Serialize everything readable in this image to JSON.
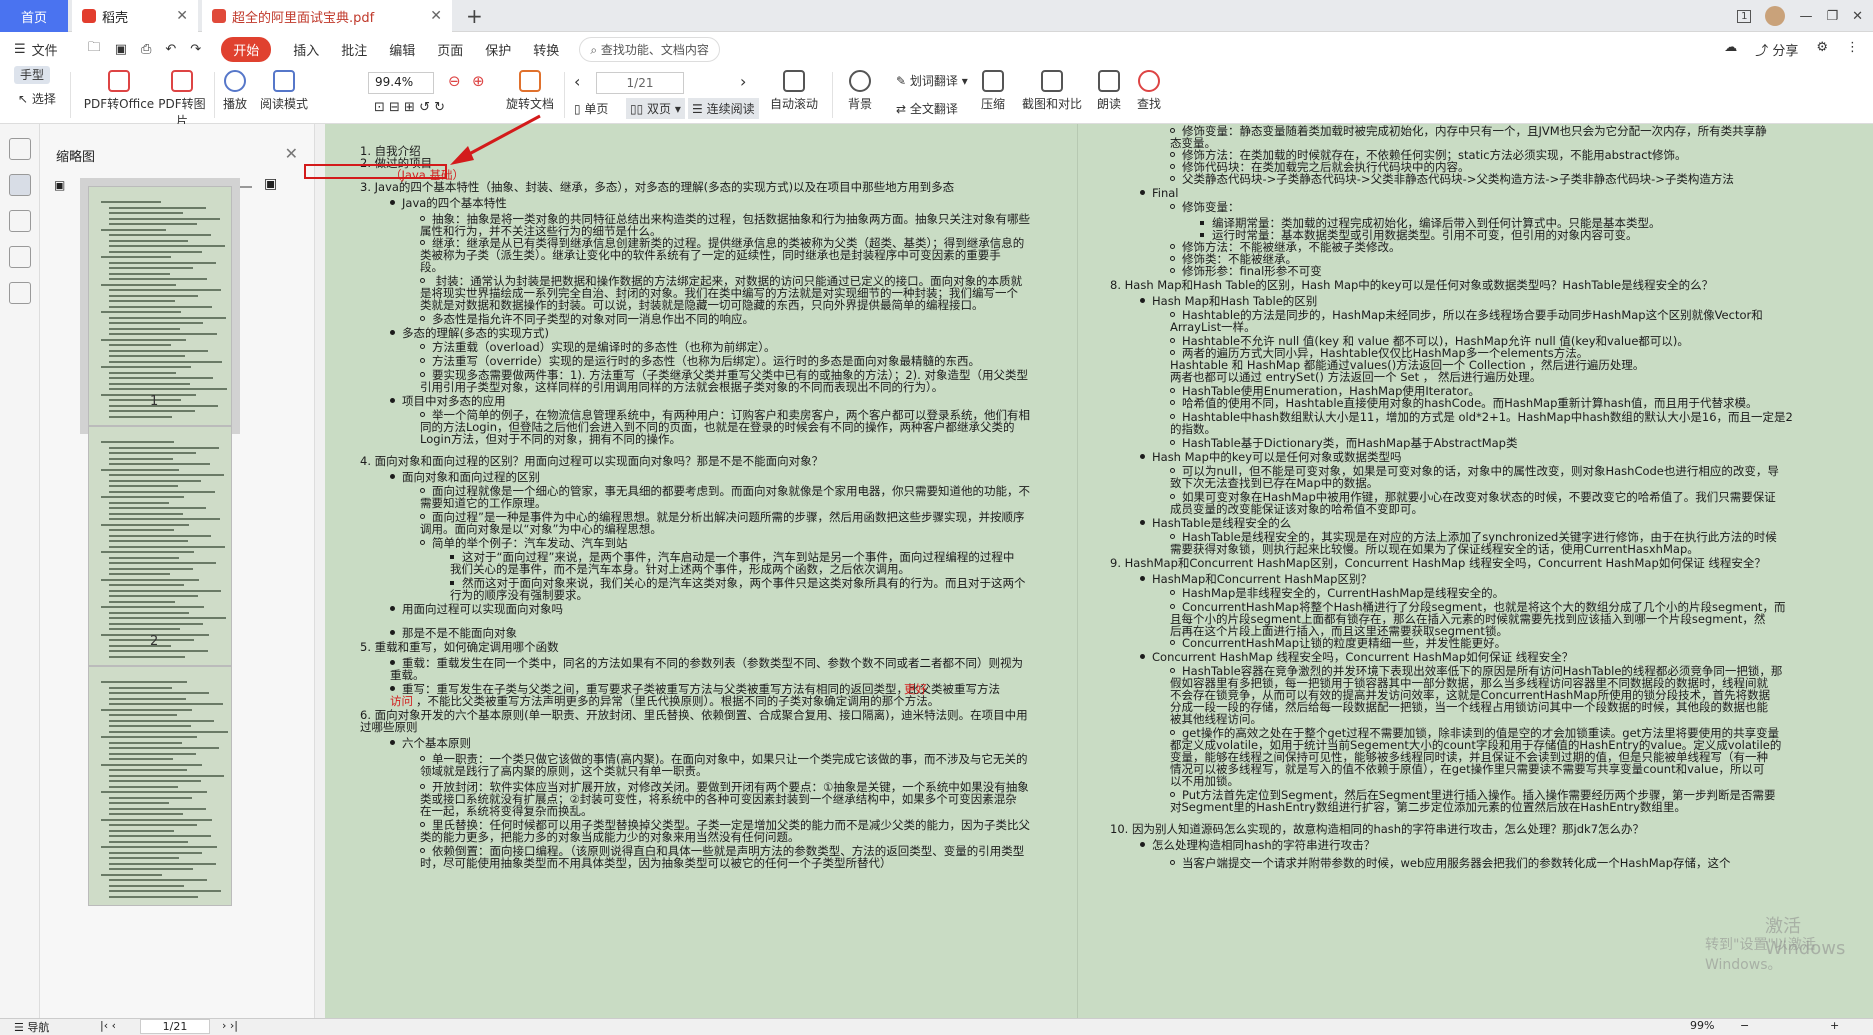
{
  "tabs": {
    "home": "首页",
    "wps": "稻壳",
    "doc": "超全的阿里面试宝典.pdf"
  },
  "winctl": {
    "badge": "1"
  },
  "menu": {
    "file": "文件",
    "start": "开始",
    "items": [
      "插入",
      "批注",
      "编辑",
      "页面",
      "保护",
      "转换"
    ],
    "search": "查找功能、文档内容",
    "share": "分享"
  },
  "toolbar": {
    "hand": "手型",
    "select": "选择",
    "pdf2office": "PDF转Office",
    "pdf2img": "PDF转图片",
    "play": "播放",
    "read": "阅读模式",
    "zoom": "99.4%",
    "rotate": "旋转文档",
    "page": "1/21",
    "single": "单页",
    "double": "双页",
    "continuous": "连续阅读",
    "autoscroll": "自动滚动",
    "bg": "背景",
    "wordtrans": "划词翻译",
    "fulltrans": "全文翻译",
    "compress": "压缩",
    "compare": "截图和对比",
    "tts": "朗读",
    "find": "查找"
  },
  "sidebar": {
    "title": "缩略图",
    "p1": "1",
    "p2": "2"
  },
  "doc_left": [
    "1.  自我介绍",
    "2.  做过的项目",
    "（Java 基础）",
    "3.  Java的四个基本特性（抽象、封装、继承，多态），对多态的理解(多态的实现方式)以及在项目中那些地方用到多态",
    "Java的四个基本特性",
    "抽象：抽象是将一类对象的共同特征总结出来构造类的过程，包括数据抽象和行为抽象两方面。抽象只关注对象有哪些",
    "属性和行为，并不关注这些行为的细节是什么。",
    "继承：继承是从已有类得到继承信息创建新类的过程。提供继承信息的类被称为父类（超类、基类）；得到继承信息的",
    "类被称为子类（派生类）。继承让变化中的软件系统有了一定的延续性，同时继承也是封装程序中可变因素的重要手",
    "段。",
    " 封装：通常认为封装是把数据和操作数据的方法绑定起来，对数据的访问只能通过已定义的接口。面向对象的本质就",
    "是将现实世界描绘成一系列完全自治、封闭的对象。我们在类中编写的方法就是对实现细节的一种封装；我们编写一个",
    "类就是对数据和数据操作的封装。可以说，封装就是隐藏一切可隐藏的东西，只向外界提供最简单的编程接口。",
    "多态性是指允许不同子类型的对象对同一消息作出不同的响应。",
    "多态的理解(多态的实现方式)",
    "方法重载（overload）实现的是编译时的多态性（也称为前绑定）。",
    "方法重写（override）实现的是运行时的多态性（也称为后绑定）。运行时的多态是面向对象最精髓的东西。",
    "要实现多态需要做两件事：1). 方法重写（子类继承父类并重写父类中已有的或抽象的方法）；2). 对象造型（用父类型",
    "引用引用子类型对象，这样同样的引用调用同样的方法就会根据子类对象的不同而表现出不同的行为）。",
    "项目中对多态的应用",
    "举一个简单的例子，在物流信息管理系统中，有两种用户：订购客户和卖房客户，两个客户都可以登录系统，他们有相",
    "同的方法Login，但登陆之后他们会进入到不同的页面，也就是在登录的时候会有不同的操作，两种客户都继承父类的",
    "Login方法，但对于不同的对象，拥有不同的操作。",
    "4.  面向对象和面向过程的区别？用面向过程可以实现面向对象吗？那是不是不能面向对象？",
    "面向对象和面向过程的区别",
    "面向过程就像是一个细心的管家，事无具细的都要考虑到。而面向对象就像是个家用电器，你只需要知道他的功能，不",
    "需要知道它的工作原理。",
    "面向过程”是一种是事件为中心的编程思想。就是分析出解决问题所需的步骤，然后用函数把这些步骤实现，并按顺序",
    "调用。面向对象是以“对象”为中心的编程思想。",
    "简单的举个例子：汽车发动、汽车到站",
    "这对于“面向过程”来说，是两个事件，汽车启动是一个事件，汽车到站是另一个事件，面向过程编程的过程中",
    "我们关心的是事件，而不是汽车本身。针对上述两个事件，形成两个函数，之后依次调用。",
    "然而这对于面向对象来说，我们关心的是汽车这类对象，两个事件只是这类对象所具有的行为。而且对于这两个",
    "行为的顺序没有强制要求。",
    "用面向过程可以实现面向对象吗",
    "那是不是不能面向对象",
    "5.  重载和重写，如何确定调用哪个函数",
    "重载：重载发生在同一个类中，同名的方法如果有不同的参数列表（参数类型不同、参数个数不同或者二者都不同）则视为",
    "重载。",
    "重写：重写发生在子类与父类之间，重写要求子类被重写方法与父类被重写方法有相同的返回类型，比父类被重写方法",
    "更好",
    "访问",
    "，不能比父类被重写方法声明更多的异常（里氏代换原则）。根据不同的子类对象确定调用的那个方法。",
    "6.  面向对象开发的六个基本原则(单一职责、开放封闭、里氏替换、依赖倒置、合成聚合复用、接口隔离)，迪米特法则。在项目中用",
    "过哪些原则",
    "六个基本原则",
    "单一职责：一个类只做它该做的事情(高内聚)。在面向对象中，如果只让一个类完成它该做的事，而不涉及与它无关的",
    "领域就是践行了高内聚的原则，这个类就只有单一职责。",
    "开放封闭：软件实体应当对扩展开放，对修改关闭。要做到开闭有两个要点：①抽象是关键，一个系统中如果没有抽象",
    "类或接口系统就没有扩展点；②封装可变性，将系统中的各种可变因素封装到一个继承结构中，如果多个可变因素混杂",
    "在一起，系统将变得复杂而换乱。",
    "里氏替换：任何时候都可以用子类型替换掉父类型。子类一定是增加父类的能力而不是减少父类的能力，因为子类比父",
    "类的能力更多，把能力多的对象当成能力少的对象来用当然没有任何问题。",
    "依赖倒置：面向接口编程。（该原则说得直白和具体一些就是声明方法的参数类型、方法的返回类型、变量的引用类型",
    "时，尽可能使用抽象类型而不用具体类型，因为抽象类型可以被它的任何一个子类型所替代）"
  ],
  "doc_right": [
    "修饰变量：静态变量随着类加载时被完成初始化，内存中只有一个，且JVM也只会为它分配一次内存，所有类共享静",
    "态变量。",
    "修饰方法：在类加载的时候就存在，不依赖任何实例；static方法必须实现，不能用abstract修饰。",
    "修饰代码块：在类加载完之后就会执行代码块中的内容。",
    "父类静态代码块->子类静态代码块->父类非静态代码块->父类构造方法->子类非静态代码块->子类构造方法",
    "Final",
    "修饰变量：",
    "编译期常量：类加载的过程完成初始化，编译后带入到任何计算式中。只能是基本类型。",
    "运行时常量：基本数据类型或引用数据类型。引用不可变，但引用的对象内容可变。",
    "修饰方法：不能被继承，不能被子类修改。",
    "修饰类：不能被继承。",
    "修饰形参：final形参不可变",
    "8.  Hash Map和Hash Table的区别，Hash Map中的key可以是任何对象或数据类型吗？HashTable是线程安全的么？",
    "Hash Map和Hash Table的区别",
    "Hashtable的方法是同步的，HashMap未经同步，所以在多线程场合要手动同步HashMap这个区别就像Vector和",
    "ArrayList一样。",
    "Hashtable不允许 null 值(key 和 value 都不可以)，HashMap允许 null 值(key和value都可以)。",
    "两者的遍历方式大同小异，Hashtable仅仅比HashMap多一个elements方法。",
    "Hashtable 和 HashMap 都能通过values()方法返回一个 Collection ，然后进行遍历处理。",
    "两者也都可以通过 entrySet() 方法返回一个 Set ， 然后进行遍历处理。",
    "HashTable使用Enumeration，HashMap使用Iterator。",
    "哈希值的使用不同，Hashtable直接使用对象的hashCode。而HashMap重新计算hash值，而且用于代替求模。",
    "Hashtable中hash数组默认大小是11，增加的方式是 old*2+1。HashMap中hash数组的默认大小是16，而且一定是2",
    "的指数。",
    "HashTable基于Dictionary类，而HashMap基于AbstractMap类",
    "Hash Map中的key可以是任何对象或数据类型吗",
    "可以为null，但不能是可变对象，如果是可变对象的话，对象中的属性改变，则对象HashCode也进行相应的改变，导",
    "致下次无法查找到已存在Map中的数据。",
    "如果可变对象在HashMap中被用作键，那就要小心在改变对象状态的时候，不要改变它的哈希值了。我们只需要保证",
    "成员变量的改变能保证该对象的哈希值不变即可。",
    "HashTable是线程安全的么",
    "HashTable是线程安全的，其实现是在对应的方法上添加了synchronized关键字进行修饰，由于在执行此方法的时候",
    "需要获得对象锁，则执行起来比较慢。所以现在如果为了保证线程安全的话，使用CurrentHasxhMap。",
    "9.  HashMap和Concurrent HashMap区别，Concurrent HashMap 线程安全吗，Concurrent HashMap如何保证 线程安全？",
    "HashMap和Concurrent HashMap区别？",
    "HashMap是非线程安全的，CurrentHashMap是线程安全的。",
    "ConcurrentHashMap将整个Hash桶进行了分段segment，也就是将这个大的数组分成了几个小的片段segment，而",
    "且每个小的片段segment上面都有锁存在，那么在插入元素的时候就需要先找到应该插入到哪一个片段segment，然",
    "后再在这个片段上面进行插入，而且这里还需要获取segment锁。",
    "ConcurrentHashMap让锁的粒度更精细一些，并发性能更好。",
    "Concurrent HashMap 线程安全吗，Concurrent HashMap如何保证 线程安全？",
    "HashTable容器在竞争激烈的并发环境下表现出效率低下的原因是所有访问HashTable的线程都必须竞争同一把锁，那",
    "假如容器里有多把锁，每一把锁用于锁容器其中一部分数据，那么当多线程访问容器里不同数据段的数据时，线程间就",
    "不会存在锁竞争，从而可以有效的提高并发访问效率，这就是ConcurrentHashMap所使用的锁分段技术，首先将数据",
    "分成一段一段的存储，然后给每一段数据配一把锁，当一个线程占用锁访问其中一个段数据的时候，其他段的数据也能",
    "被其他线程访问。",
    "get操作的高效之处在于整个get过程不需要加锁，除非读到的值是空的才会加锁重读。get方法里将要使用的共享变量",
    "都定义成volatile，如用于统计当前Segement大小的count字段和用于存储值的HashEntry的value。定义成volatile的",
    "变量，能够在线程之间保持可见性，能够被多线程同时读，并且保证不会读到过期的值，但是只能被单线程写（有一种",
    "情况可以被多线程写，就是写入的值不依赖于原值），在get操作里只需要读不需要写共享变量count和value，所以可",
    "以不用加锁。",
    "Put方法首先定位到Segment，然后在Segment里进行插入操作。插入操作需要经历两个步骤，第一步判断是否需要",
    "对Segment里的HashEntry数组进行扩容，第二步定位添加元素的位置然后放在HashEntry数组里。",
    "10.  因为别人知道源码怎么实现的，故意构造相同的hash的字符串进行攻击，怎么处理？那jdk7怎么办？",
    "怎么处理构造相同hash的字符串进行攻击？",
    "当客户端提交一个请求并附带参数的时候，web应用服务器会把我们的参数转化成一个HashMap存储，这个"
  ],
  "watermark": {
    "line1": "激活 Windows",
    "line2": "转到\"设置\"以激活 Windows。"
  },
  "statusbar": {
    "nav": "导航",
    "page": "1/21",
    "zoom": "99%"
  }
}
